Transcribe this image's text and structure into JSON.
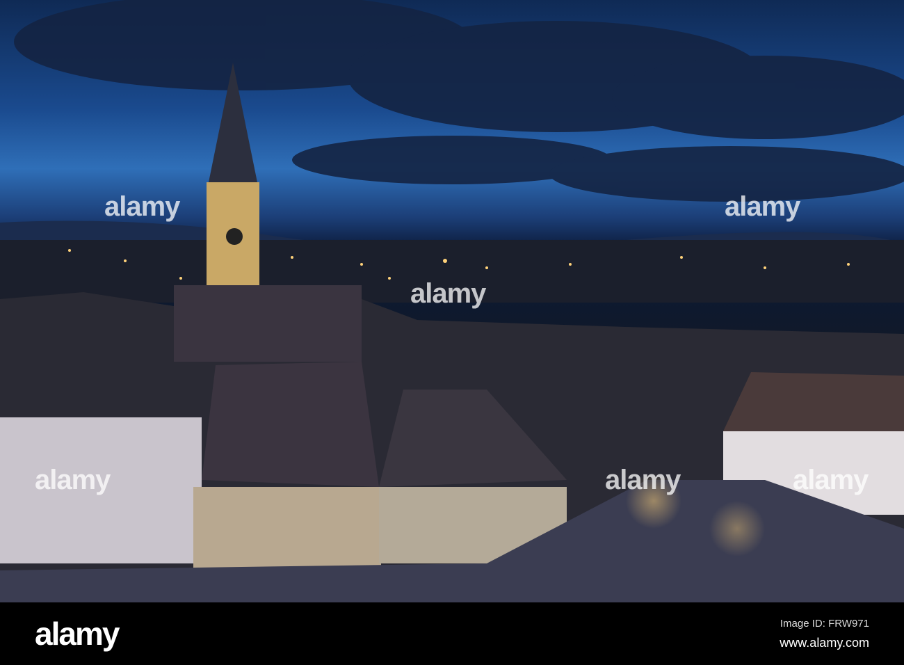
{
  "watermark": {
    "text": "alamy"
  },
  "footer": {
    "logo": "alamy",
    "image_id": "Image ID: FRW971",
    "url": "www.alamy.com"
  }
}
